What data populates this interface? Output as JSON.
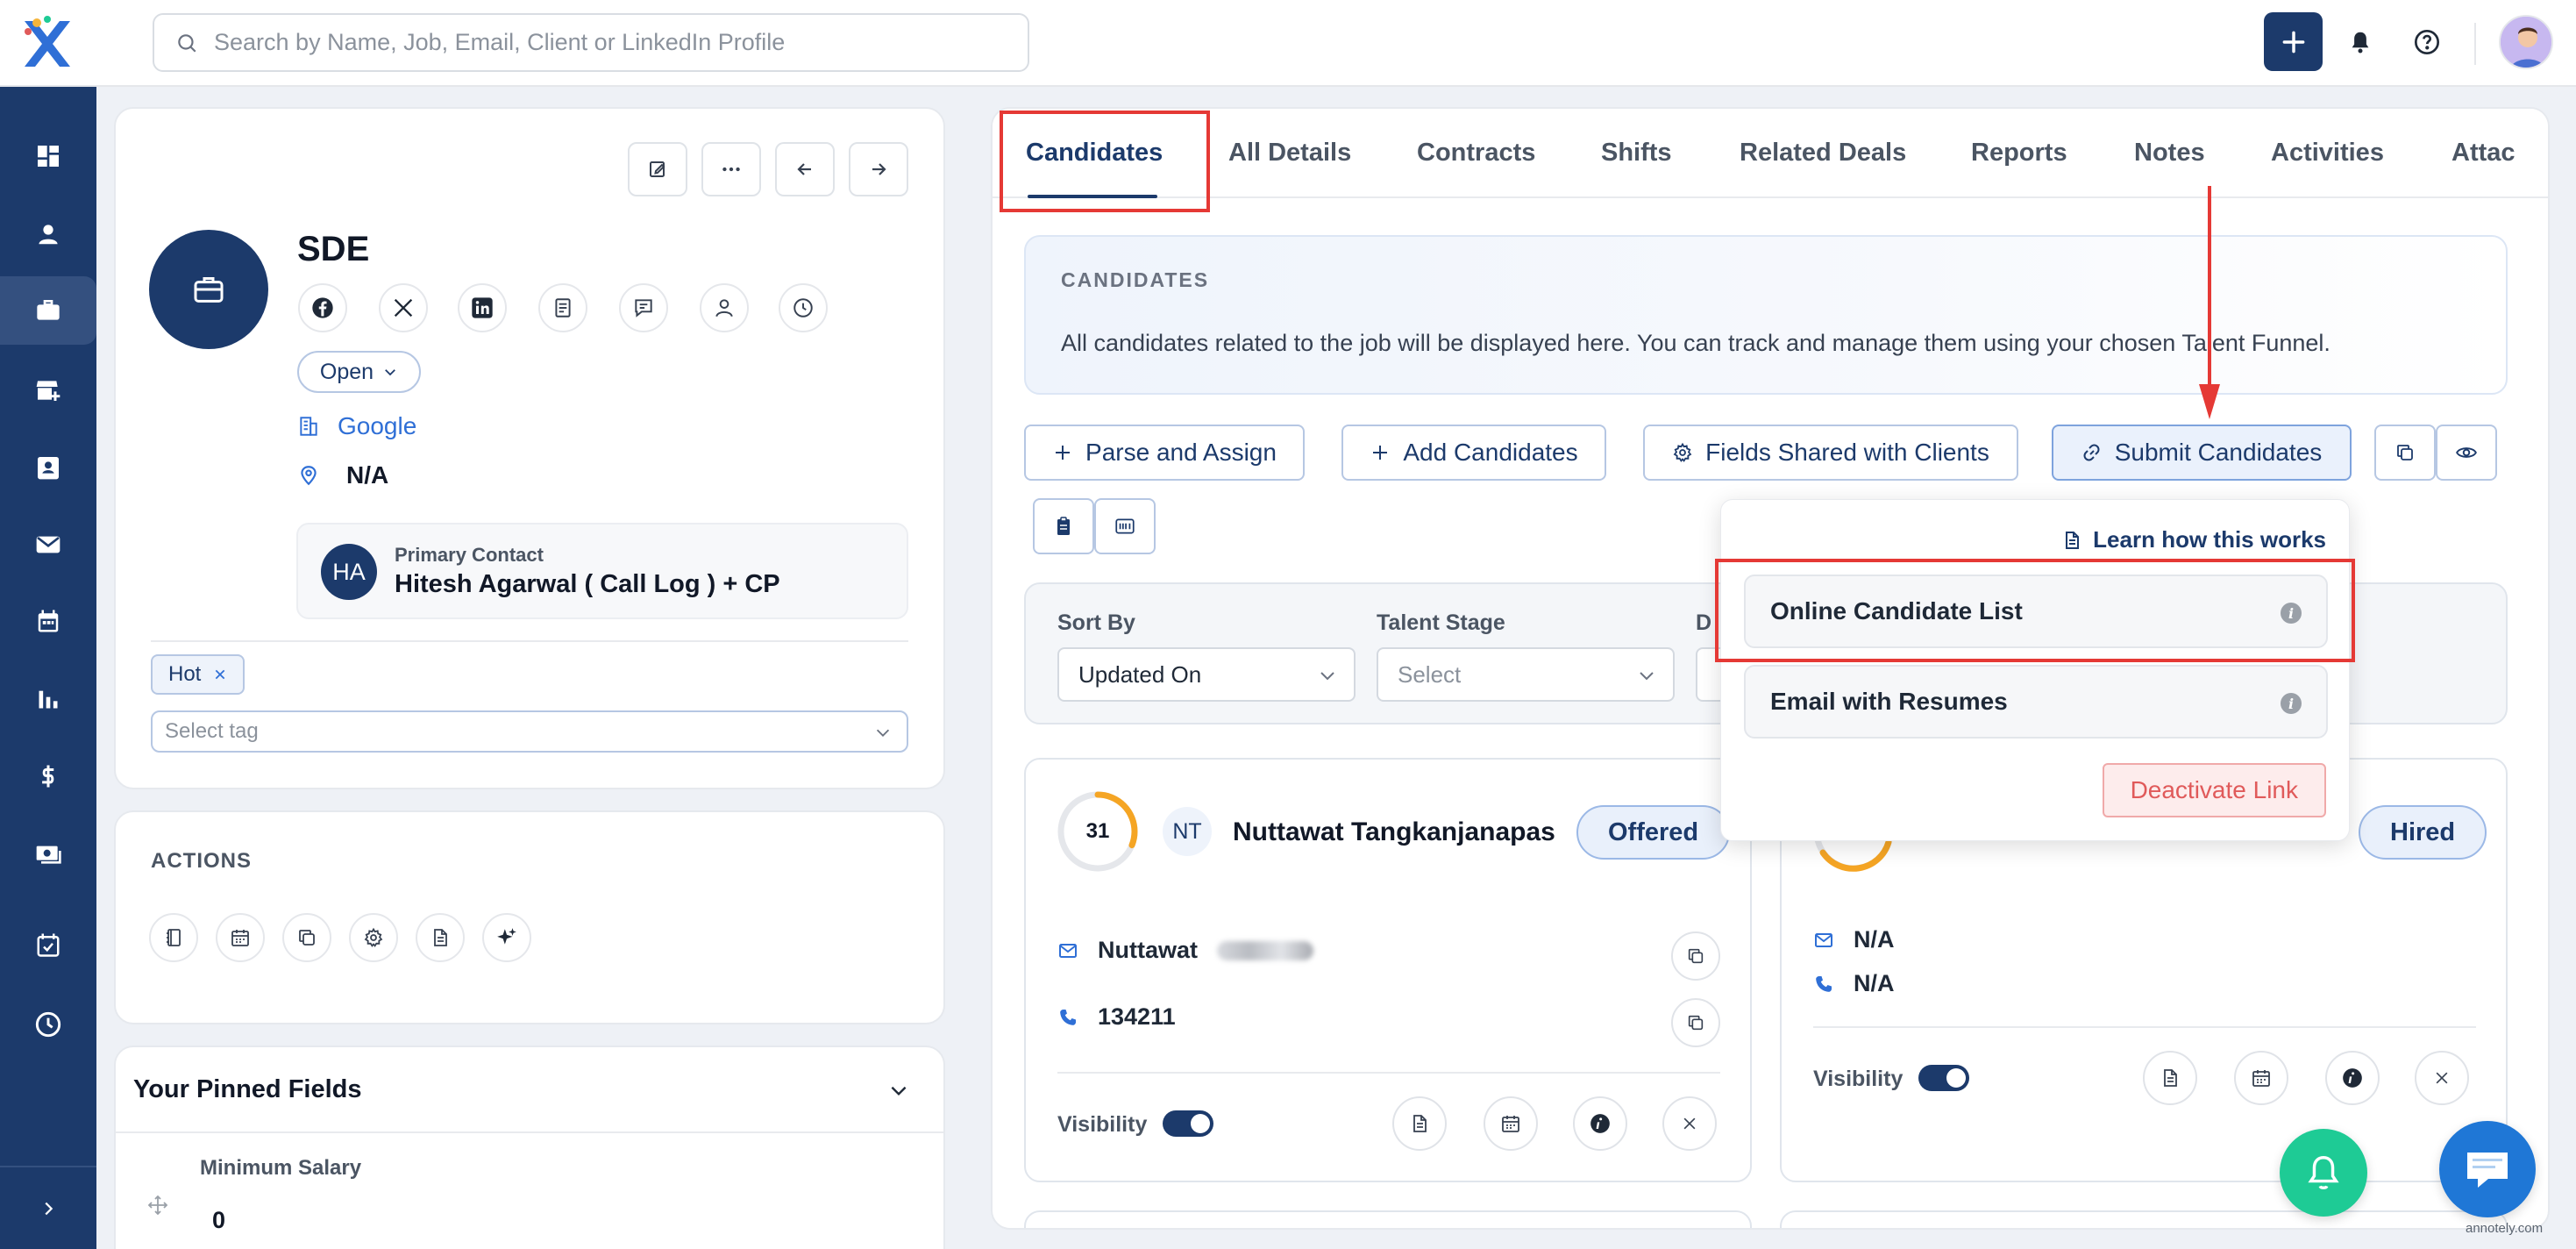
{
  "search": {
    "placeholder": "Search by Name, Job, Email, Client or LinkedIn Profile"
  },
  "job": {
    "title": "SDE",
    "status": "Open",
    "company": "Google",
    "location": "N/A",
    "primary_contact_label": "Primary Contact",
    "primary_contact_initials": "HA",
    "primary_contact_name": "Hitesh Agarwal ( Call Log ) + CP",
    "tag": "Hot",
    "tag_placeholder": "Select tag"
  },
  "actions": {
    "title": "ACTIONS"
  },
  "pinned": {
    "title": "Your Pinned Fields",
    "field_label": "Minimum Salary",
    "field_value": "0"
  },
  "tabs": [
    "Candidates",
    "All Details",
    "Contracts",
    "Shifts",
    "Related Deals",
    "Reports",
    "Notes",
    "Activities",
    "Attac"
  ],
  "info": {
    "title": "CANDIDATES",
    "text": "All candidates related to the job will be displayed here. You can track and manage them using your chosen Talent Funnel."
  },
  "buttons": {
    "parse_assign": "Parse and Assign",
    "add_candidates": "Add Candidates",
    "fields_shared": "Fields Shared with Clients",
    "submit_candidates": "Submit Candidates"
  },
  "filters": {
    "sort_by_label": "Sort By",
    "sort_by_value": "Updated On",
    "talent_stage_label": "Talent Stage",
    "talent_stage_placeholder": "Select",
    "third_label": "D"
  },
  "dropdown": {
    "learn": "Learn how this works",
    "items": [
      "Online Candidate List",
      "Email with Resumes"
    ],
    "deactivate": "Deactivate Link"
  },
  "candidates": [
    {
      "score": "31",
      "score_fraction": 0.31,
      "initials": "NT",
      "name": "Nuttawat Tangkanjanapas",
      "stage": "Offered",
      "email_prefix": "Nuttawat",
      "phone": "134211",
      "visibility_label": "Visibility"
    },
    {
      "stage": "Hired",
      "email": "N/A",
      "phone": "N/A",
      "visibility_label": "Visibility"
    }
  ],
  "watermark": "annotely.com",
  "colors": {
    "brand": "#1c3a6b",
    "link": "#2f6fd6",
    "annotation": "#e53935",
    "success": "#1ecb95",
    "danger": "#e05a5a"
  }
}
